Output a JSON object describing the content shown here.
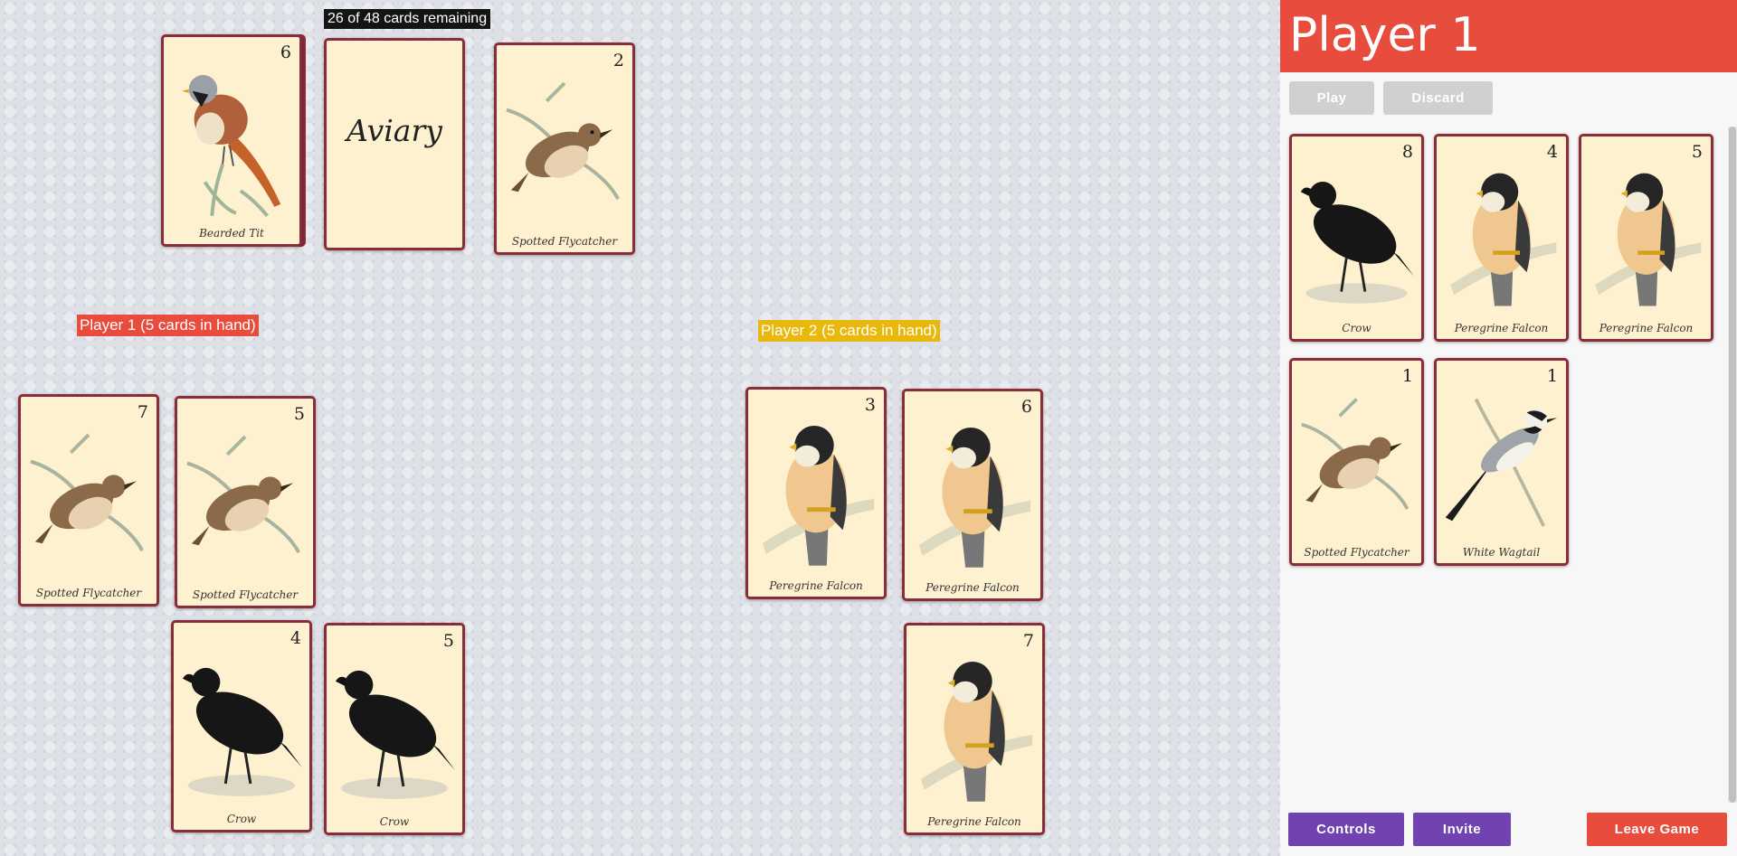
{
  "deck": {
    "counter": "26 of 48 cards remaining",
    "title": "Aviary"
  },
  "table": {
    "discard_top": {
      "rank": "6",
      "name": "Bearded Tit",
      "bird": "bearded-tit"
    },
    "exposed": {
      "rank": "2",
      "name": "Spotted Flycatcher",
      "bird": "flycatcher"
    }
  },
  "players": {
    "p1": {
      "label": "Player 1 (5 cards in hand)",
      "color": "#e74c3c",
      "cards": [
        {
          "rank": "7",
          "name": "Spotted Flycatcher",
          "bird": "flycatcher"
        },
        {
          "rank": "5",
          "name": "Spotted Flycatcher",
          "bird": "flycatcher"
        },
        {
          "rank": "4",
          "name": "Crow",
          "bird": "crow"
        },
        {
          "rank": "5",
          "name": "Crow",
          "bird": "crow"
        }
      ]
    },
    "p2": {
      "label": "Player 2 (5 cards in hand)",
      "color": "#e8b80c",
      "cards": [
        {
          "rank": "3",
          "name": "Peregrine Falcon",
          "bird": "falcon"
        },
        {
          "rank": "6",
          "name": "Peregrine Falcon",
          "bird": "falcon"
        },
        {
          "rank": "7",
          "name": "Peregrine Falcon",
          "bird": "falcon"
        }
      ]
    }
  },
  "sidebar": {
    "title": "Player 1",
    "play_label": "Play",
    "discard_label": "Discard",
    "hand": [
      {
        "rank": "8",
        "name": "Crow",
        "bird": "crow"
      },
      {
        "rank": "4",
        "name": "Peregrine Falcon",
        "bird": "falcon"
      },
      {
        "rank": "5",
        "name": "Peregrine Falcon",
        "bird": "falcon"
      },
      {
        "rank": "1",
        "name": "Spotted Flycatcher",
        "bird": "flycatcher"
      },
      {
        "rank": "1",
        "name": "White Wagtail",
        "bird": "wagtail"
      }
    ],
    "controls_label": "Controls",
    "invite_label": "Invite",
    "leave_label": "Leave Game"
  },
  "colors": {
    "accent_red": "#e74c3c",
    "accent_yellow": "#e8b80c",
    "purple": "#7043b1",
    "card_border": "#8b2c3b",
    "card_face": "#fdf1cf"
  }
}
